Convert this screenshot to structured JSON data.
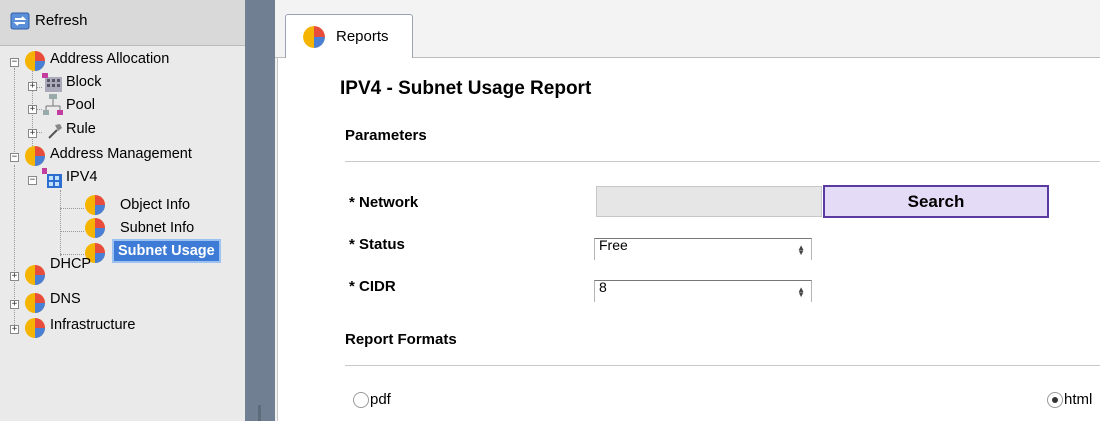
{
  "sidebar": {
    "refresh_label": "Refresh",
    "tree": [
      {
        "label": "Address Allocation",
        "icon": "report-pie-icon"
      },
      {
        "label": "Block",
        "icon": "block-grid-icon"
      },
      {
        "label": "Pool",
        "icon": "pool-network-icon"
      },
      {
        "label": "Rule",
        "icon": "hammer-icon"
      },
      {
        "label": "Address Management",
        "icon": "report-pie-icon"
      },
      {
        "label": "IPV4",
        "icon": "ipv4-grid-icon"
      },
      {
        "label": "Object Info",
        "icon": "report-pie-icon"
      },
      {
        "label": "Subnet Info",
        "icon": "report-pie-icon"
      },
      {
        "label": "Subnet Usage",
        "icon": "report-pie-icon"
      },
      {
        "label": "DHCP",
        "icon": "report-pie-icon"
      },
      {
        "label": "DNS",
        "icon": "report-pie-icon"
      },
      {
        "label": "Infrastructure",
        "icon": "report-pie-icon"
      }
    ]
  },
  "tabs": [
    {
      "label": "Reports"
    }
  ],
  "report": {
    "title": "IPV4 - Subnet Usage Report",
    "parameters_heading": "Parameters",
    "network_label": "* Network",
    "network_value": "",
    "search_label": "Search",
    "status_label": "* Status",
    "status_value": "Free",
    "cidr_label": "* CIDR",
    "cidr_value": "8",
    "formats_heading": "Report Formats",
    "format_pdf": "pdf",
    "format_html": "html",
    "selected_format": "html"
  },
  "colors": {
    "sidebar_bg": "#eaeaea",
    "divider": "#707f91",
    "selected_bg": "#3d7bd6",
    "search_bg": "#e4dcf7",
    "search_border": "#5a3aa0"
  }
}
